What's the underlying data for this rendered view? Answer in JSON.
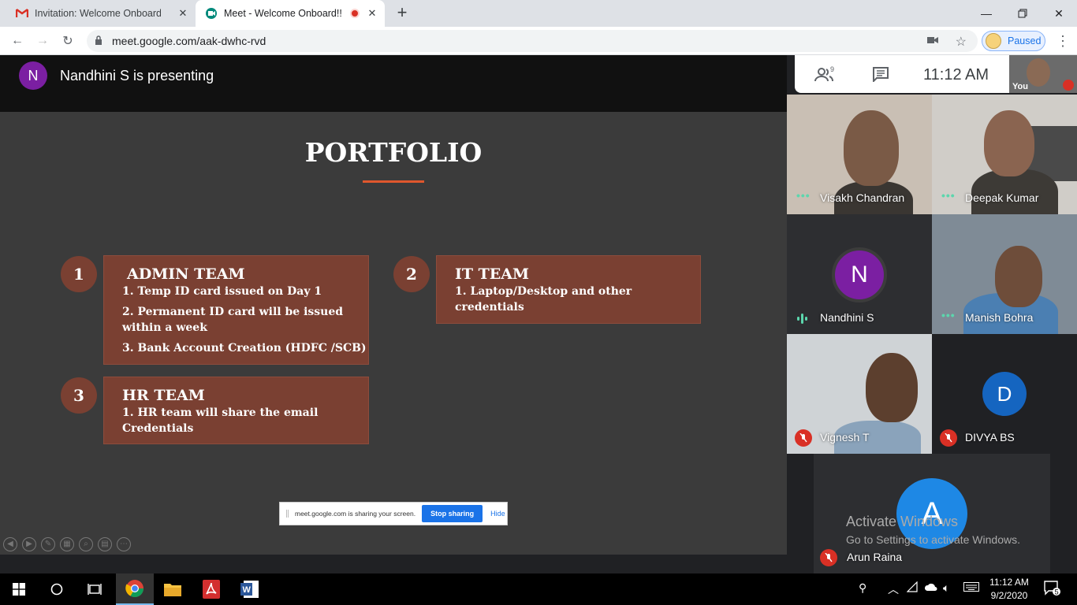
{
  "browser": {
    "tabs": [
      {
        "title": "Invitation: Welcome Onboard!!! @",
        "favicon": "gmail-icon"
      },
      {
        "title": "Meet - Welcome Onboard!!!",
        "favicon": "meet-icon",
        "recording": true
      }
    ],
    "url": "meet.google.com/aak-dwhc-rvd",
    "profile_status": "Paused"
  },
  "meet": {
    "presenter": {
      "initial": "N",
      "text": "Nandhini S is presenting"
    },
    "people_count": "9",
    "clock": "11:12 AM",
    "self_label": "You",
    "share_bar": {
      "message": "meet.google.com is sharing your screen.",
      "stop_label": "Stop sharing",
      "hide_label": "Hide"
    },
    "participants": [
      {
        "name": "Visakh Chandran",
        "status": "active"
      },
      {
        "name": "Deepak Kumar",
        "status": "active"
      },
      {
        "name": "Nandhini S",
        "status": "speaking",
        "initial": "N"
      },
      {
        "name": "Manish Bohra",
        "status": "active"
      },
      {
        "name": "Vignesh T",
        "status": "muted"
      },
      {
        "name": "DIVYA BS",
        "status": "muted",
        "initial": "D"
      },
      {
        "name": "Arun Raina",
        "status": "muted",
        "initial": "A"
      }
    ]
  },
  "slide": {
    "title": "PORTFOLIO",
    "sections": [
      {
        "number": "1",
        "heading": "ADMIN TEAM",
        "items": [
          "1. Temp ID card issued on Day 1",
          "2. Permanent ID card will be issued",
          "within a week",
          "3.  Bank Account Creation (HDFC /SCB)"
        ]
      },
      {
        "number": "2",
        "heading": "IT TEAM",
        "items": [
          "1. Laptop/Desktop and other",
          "credentials"
        ]
      },
      {
        "number": "3",
        "heading": "HR TEAM",
        "items": [
          "1. HR team will share the email",
          "Credentials"
        ]
      }
    ]
  },
  "watermark": {
    "line1": "Activate Windows",
    "line2": "Go to Settings to activate Windows."
  },
  "taskbar": {
    "time": "11:12 AM",
    "date": "9/2/2020",
    "notifications": "5"
  },
  "colors": {
    "slide_box": "#7a4032",
    "accent_line": "#e0572d",
    "muted_red": "#d93025",
    "meet_green": "#5cd6ad"
  }
}
